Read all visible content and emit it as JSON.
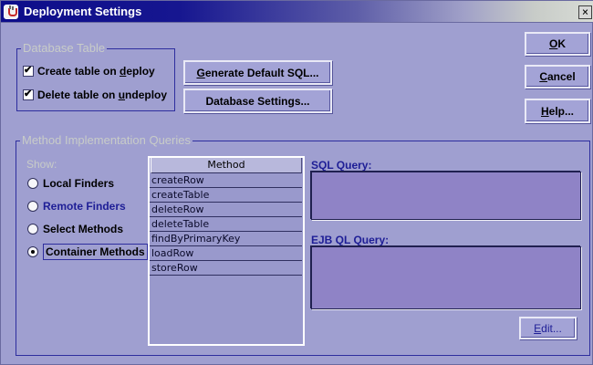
{
  "window": {
    "title": "Deployment Settings",
    "close_glyph": "×"
  },
  "database_table": {
    "group_title": "Database Table",
    "create_table": {
      "label_pre": "Create table on ",
      "label_key": "d",
      "label_post": "eploy",
      "checked": true
    },
    "delete_table": {
      "label_pre": "Delete table on ",
      "label_key": "u",
      "label_post": "ndeploy",
      "checked": true
    }
  },
  "buttons": {
    "generate_sql": {
      "key": "G",
      "rest": "enerate Default SQL..."
    },
    "database_settings": {
      "text": "Database Settings..."
    },
    "ok": {
      "key": "O",
      "rest": "K"
    },
    "cancel": {
      "key": "C",
      "rest": "ancel"
    },
    "help": {
      "key": "H",
      "rest": "elp..."
    },
    "edit": {
      "key": "E",
      "rest": "dit..."
    }
  },
  "method_queries": {
    "group_title": "Method Implementation Queries",
    "show_label": "Show:",
    "options": [
      {
        "label": "Local Finders",
        "selected": false,
        "color": "#000000"
      },
      {
        "label": "Remote Finders",
        "selected": false,
        "color": "#1e1e96"
      },
      {
        "label": "Select Methods",
        "selected": false,
        "color": "#000000"
      },
      {
        "label": "Container Methods",
        "selected": true,
        "color": "#000000"
      }
    ],
    "table_header": "Method",
    "methods": [
      "createRow",
      "createTable",
      "deleteRow",
      "deleteTable",
      "findByPrimaryKey",
      "loadRow",
      "storeRow"
    ],
    "sql_query_label": "SQL Query:",
    "ejb_ql_label": "EJB QL Query:",
    "sql_query_value": "",
    "ejb_ql_value": ""
  },
  "colors": {
    "background": "#9f9fd0",
    "title_start": "#0d0d8a",
    "label_blue": "#1e1e96",
    "group_title": "#c8ccc8"
  }
}
